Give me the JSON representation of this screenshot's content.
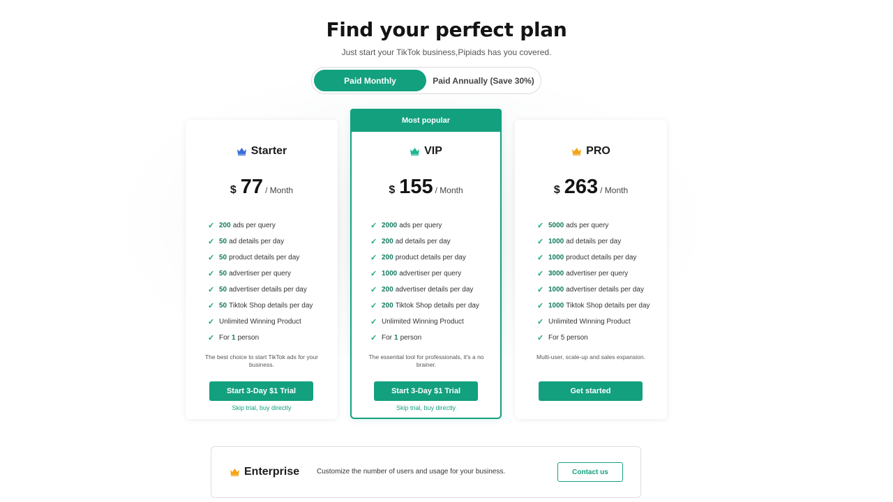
{
  "header": {
    "title": "Find your perfect plan",
    "subtitle": "Just start your TikTok business,Pipiads has you covered."
  },
  "billing_toggle": {
    "monthly_label": "Paid Monthly",
    "annual_label": "Paid Annually (Save 30%)",
    "selected": "monthly"
  },
  "plans": [
    {
      "name": "Starter",
      "crown_color": "#3b6fd8",
      "currency": "$",
      "price": "77",
      "period": "/ Month",
      "features": [
        {
          "value": "200",
          "text": "ads per query"
        },
        {
          "value": "50",
          "text": "ad details per day"
        },
        {
          "value": "50",
          "text": "product details per day"
        },
        {
          "value": "50",
          "text": "advertiser per query"
        },
        {
          "value": "50",
          "text": "advertiser details per day"
        },
        {
          "value": "50",
          "text": "Tiktok Shop details per day"
        },
        {
          "value": "",
          "text": "Unlimited Winning Product"
        },
        {
          "value": "1",
          "text": "person",
          "prefix": "For"
        }
      ],
      "description": "The best choice to start TikTok ads for your business.",
      "cta_label": "Start 3-Day $1 Trial",
      "skip_label": "Skip trial, buy directly"
    },
    {
      "name": "VIP",
      "badge": "Most popular",
      "crown_color": "#1fb58f",
      "currency": "$",
      "price": "155",
      "period": "/ Month",
      "features": [
        {
          "value": "2000",
          "text": "ads per query"
        },
        {
          "value": "200",
          "text": "ad details per day"
        },
        {
          "value": "200",
          "text": "product details per day"
        },
        {
          "value": "1000",
          "text": "advertiser per query"
        },
        {
          "value": "200",
          "text": "advertiser details per day"
        },
        {
          "value": "200",
          "text": "Tiktok Shop details per day"
        },
        {
          "value": "",
          "text": "Unlimited Winning Product"
        },
        {
          "value": "1",
          "text": "person",
          "prefix": "For"
        }
      ],
      "description": "The essential tool for professionals, it's a no brainer.",
      "cta_label": "Start 3-Day $1 Trial",
      "skip_label": "Skip trial, buy directly"
    },
    {
      "name": "PRO",
      "crown_color": "#f2a51a",
      "currency": "$",
      "price": "263",
      "period": "/ Month",
      "features": [
        {
          "value": "5000",
          "text": "ads per query"
        },
        {
          "value": "1000",
          "text": "ad details per day"
        },
        {
          "value": "1000",
          "text": "product details per day"
        },
        {
          "value": "3000",
          "text": "advertiser per query"
        },
        {
          "value": "1000",
          "text": "advertiser details per day"
        },
        {
          "value": "1000",
          "text": "Tiktok Shop details per day"
        },
        {
          "value": "",
          "text": "Unlimited Winning Product"
        },
        {
          "value": "",
          "text": "For 5 person"
        }
      ],
      "description": "Multi-user, scale-up and sales expansion.",
      "cta_label": "Get started"
    }
  ],
  "enterprise": {
    "name": "Enterprise",
    "crown_color": "#f2a51a",
    "description": "Customize the number of users and usage for your business.",
    "cta_label": "Contact us"
  },
  "colors": {
    "accent": "#13a07e"
  }
}
